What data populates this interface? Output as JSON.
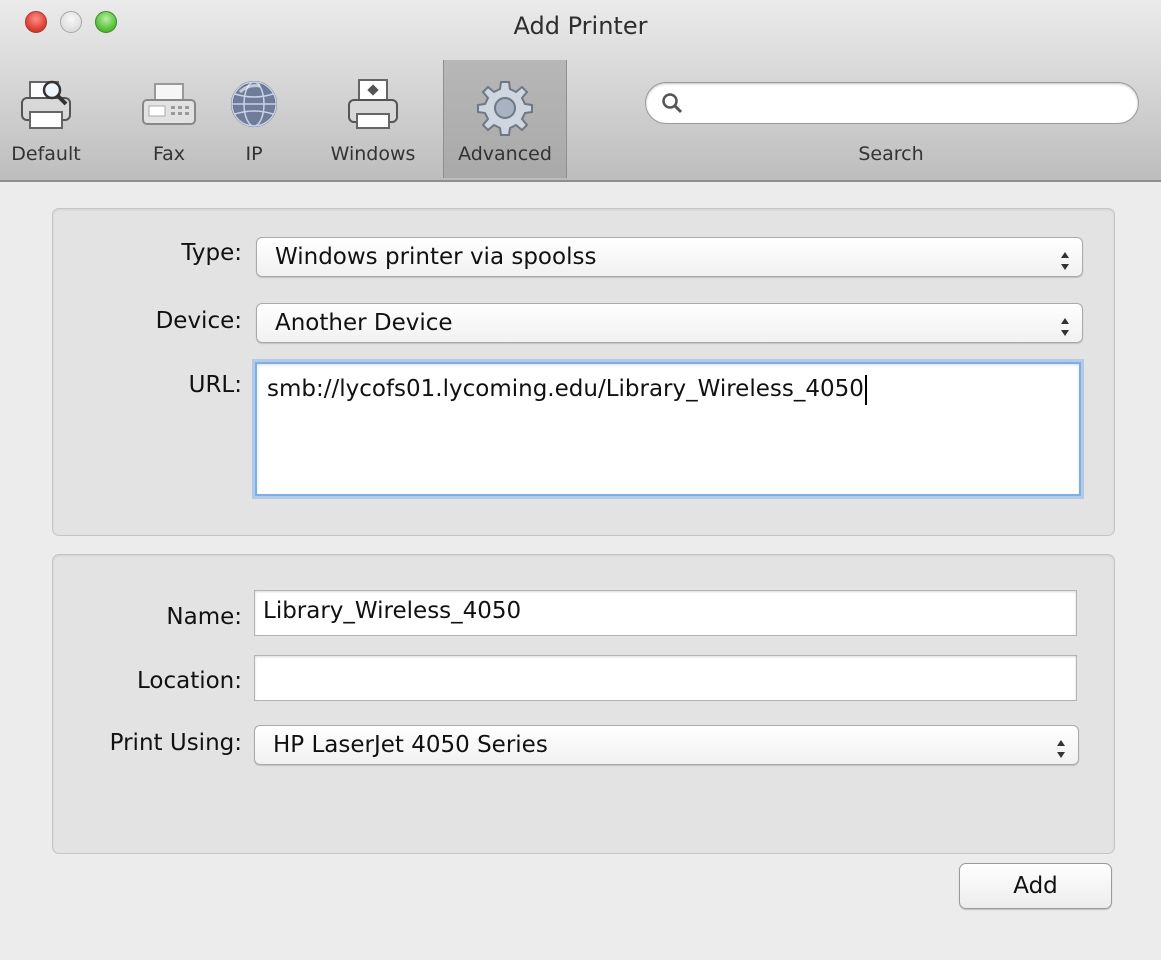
{
  "window": {
    "title": "Add Printer"
  },
  "toolbar": {
    "items": [
      {
        "label": "Default",
        "icon": "default-printer-icon"
      },
      {
        "label": "Fax",
        "icon": "fax-icon"
      },
      {
        "label": "IP",
        "icon": "globe-icon"
      },
      {
        "label": "Windows",
        "icon": "windows-printer-icon"
      },
      {
        "label": "Advanced",
        "icon": "gear-icon",
        "active": true
      }
    ],
    "search": {
      "label": "Search",
      "value": "",
      "icon": "search-icon"
    }
  },
  "connection": {
    "type_label": "Type:",
    "type_value": "Windows printer via spoolss",
    "device_label": "Device:",
    "device_value": "Another Device",
    "url_label": "URL:",
    "url_value": "smb://lycofs01.lycoming.edu/Library_Wireless_4050"
  },
  "details": {
    "name_label": "Name:",
    "name_value": "Library_Wireless_4050",
    "location_label": "Location:",
    "location_value": "",
    "print_using_label": "Print Using:",
    "print_using_value": "HP LaserJet 4050 Series"
  },
  "actions": {
    "add_label": "Add"
  },
  "colors": {
    "focus_ring": "#7eaee8",
    "close": "#e0443a",
    "zoom": "#5cc33f"
  }
}
